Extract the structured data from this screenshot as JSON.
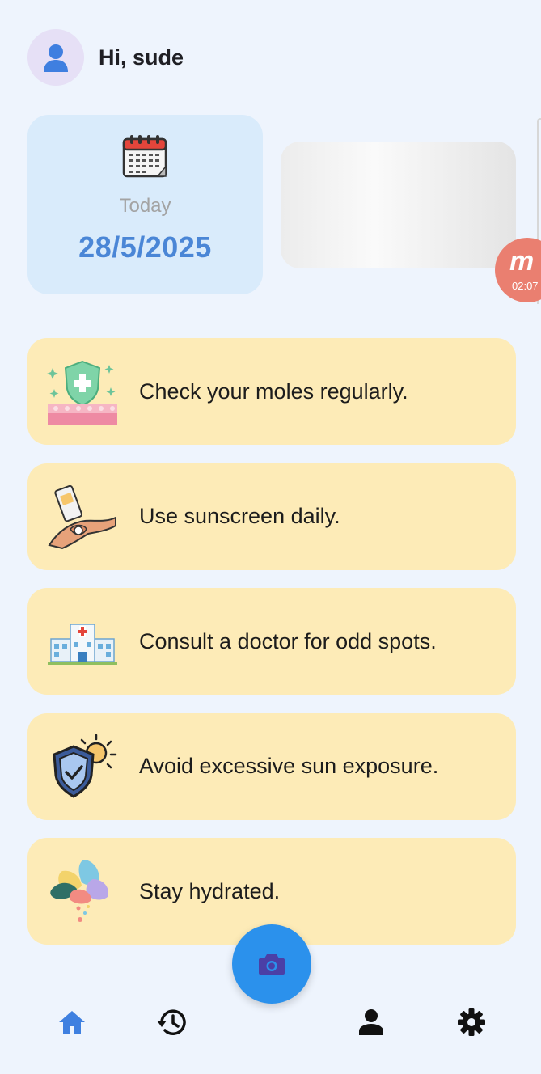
{
  "header": {
    "greeting": "Hi, sude",
    "avatar_icon": "user-avatar-icon"
  },
  "date_card": {
    "label": "Today",
    "date": "28/5/2025",
    "icon": "calendar-icon"
  },
  "recording_overlay": {
    "time": "02:07",
    "logo_glyph": "m",
    "color": "#ea7f70"
  },
  "tips": [
    {
      "label": "Check your moles regularly.",
      "icon": "skin-shield-icon"
    },
    {
      "label": "Use sunscreen daily.",
      "icon": "sunscreen-hand-icon"
    },
    {
      "label": "Consult a doctor for odd spots.",
      "icon": "hospital-icon"
    },
    {
      "label": "Avoid excessive sun exposure.",
      "icon": "sun-shield-icon"
    },
    {
      "label": "Stay hydrated.",
      "icon": "water-drops-icon"
    }
  ],
  "camera_button": {
    "icon": "camera-icon"
  },
  "nav": {
    "items": [
      {
        "icon": "home-icon",
        "active": true
      },
      {
        "icon": "history-icon",
        "active": false
      },
      {
        "icon": "profile-icon",
        "active": false
      },
      {
        "icon": "settings-icon",
        "active": false
      }
    ]
  },
  "colors": {
    "background": "#eef4fd",
    "date_card": "#d9ebfb",
    "date_text": "#4a86d6",
    "tip_card": "#fdebb7",
    "fab": "#2b91ec",
    "nav_active": "#3f80e0"
  }
}
